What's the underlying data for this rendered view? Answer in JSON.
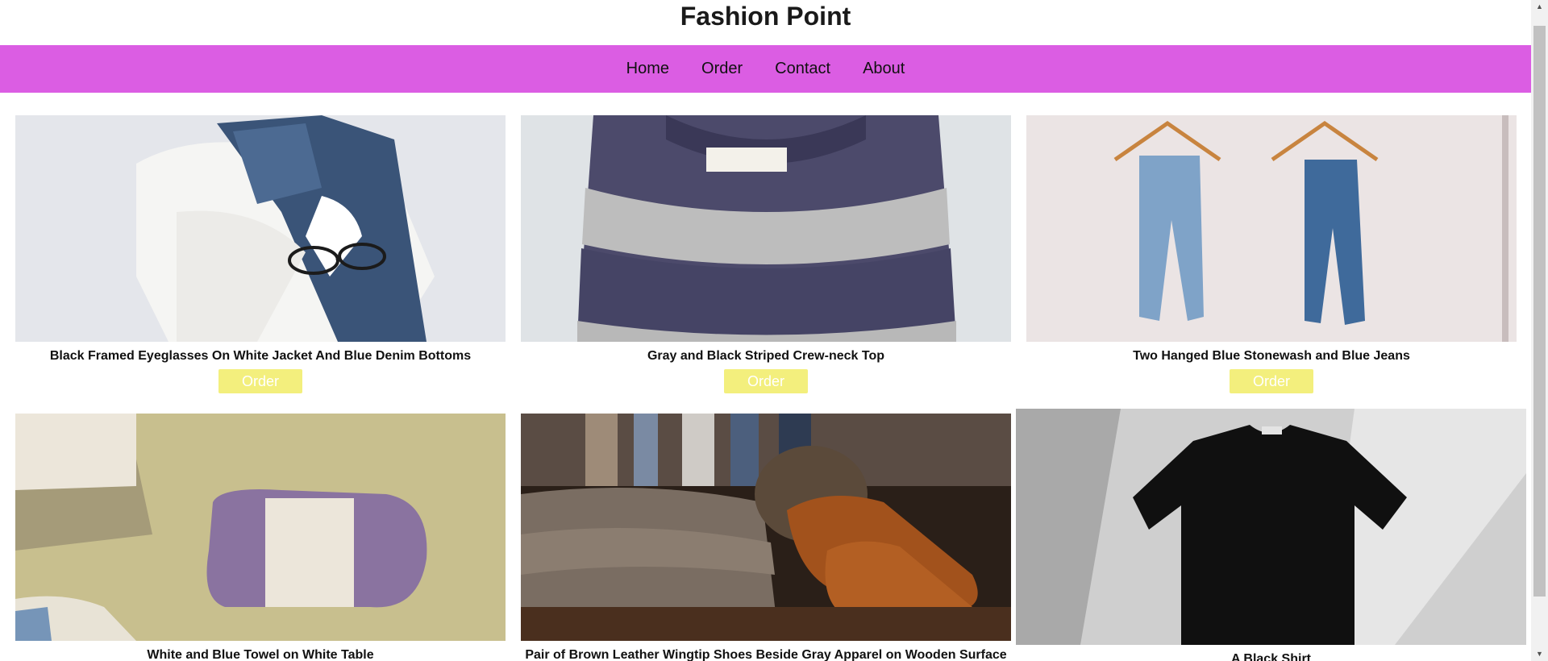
{
  "site": {
    "title": "Fashion Point"
  },
  "nav": {
    "items": [
      "Home",
      "Order",
      "Contact",
      "About"
    ]
  },
  "products": [
    {
      "caption": "Black Framed Eyeglasses On White Jacket And Blue Denim Bottoms",
      "button": "Order"
    },
    {
      "caption": "Gray and Black Striped Crew-neck Top",
      "button": "Order"
    },
    {
      "caption": "Two Hanged Blue Stonewash and Blue Jeans",
      "button": "Order"
    },
    {
      "caption": "White and Blue Towel on White Table"
    },
    {
      "caption": "Pair of Brown Leather Wingtip Shoes Beside Gray Apparel on Wooden Surface"
    },
    {
      "caption": "A Black Shirt"
    }
  ],
  "colors": {
    "nav_bg": "#db5de3",
    "button_bg": "#f3ef7d"
  }
}
